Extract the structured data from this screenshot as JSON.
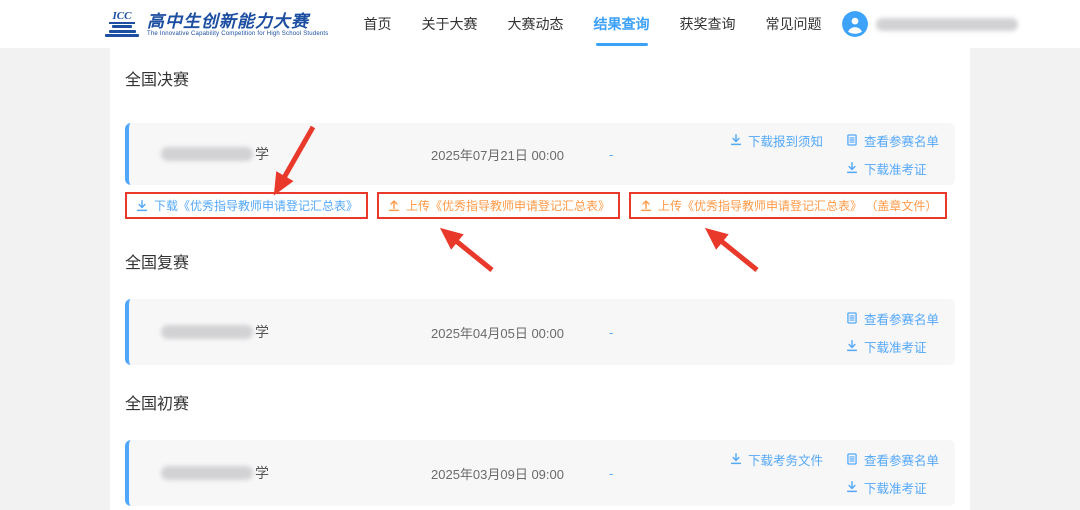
{
  "header": {
    "logo": {
      "icc": "ICC",
      "title": "高中生创新能力大赛",
      "subtitle": "The Innovative Capability Competition for High School Students"
    },
    "nav": [
      {
        "label": "首页",
        "active": false
      },
      {
        "label": "关于大赛",
        "active": false
      },
      {
        "label": "大赛动态",
        "active": false
      },
      {
        "label": "结果查询",
        "active": true
      },
      {
        "label": "获奖查询",
        "active": false
      },
      {
        "label": "常见问题",
        "active": false
      }
    ],
    "user": {
      "avatar_icon": "user-avatar-icon",
      "name_redacted": true
    }
  },
  "sections": [
    {
      "title": "全国决赛",
      "card": {
        "school_redacted": true,
        "school_suffix": "学",
        "datetime": "2025年07月21日 00:00",
        "dash": "-",
        "links": [
          {
            "icon": "download-icon",
            "label": "下载报到须知"
          },
          {
            "icon": "list-icon",
            "label": "查看参赛名单"
          },
          {
            "icon": "download-icon",
            "label": "下载准考证"
          }
        ]
      },
      "action_buttons": [
        {
          "icon": "download-icon",
          "label": "下载《优秀指导教师申请登记汇总表》",
          "color": "blue",
          "highlighted": true
        },
        {
          "icon": "upload-icon",
          "label": "上传《优秀指导教师申请登记汇总表》",
          "color": "orange",
          "highlighted": true
        },
        {
          "icon": "upload-icon",
          "label": "上传《优秀指导教师申请登记汇总表》 （盖章文件）",
          "color": "orange",
          "highlighted": true
        }
      ]
    },
    {
      "title": "全国复赛",
      "card": {
        "school_redacted": true,
        "school_suffix": "学",
        "datetime": "2025年04月05日 00:00",
        "dash": "-",
        "links": [
          {
            "icon": "list-icon",
            "label": "查看参赛名单"
          },
          {
            "icon": "download-icon",
            "label": "下载准考证"
          }
        ]
      }
    },
    {
      "title": "全国初赛",
      "card": {
        "school_redacted": true,
        "school_suffix": "学",
        "datetime": "2025年03月09日 09:00",
        "dash": "-",
        "links": [
          {
            "icon": "download-icon",
            "label": "下载考务文件"
          },
          {
            "icon": "list-icon",
            "label": "查看参赛名单"
          },
          {
            "icon": "download-icon",
            "label": "下载准考证"
          }
        ]
      }
    }
  ],
  "annotations": {
    "arrow_count": 3,
    "arrow_color": "#e8392b",
    "highlight_box_color": "#e8392b"
  },
  "colors": {
    "link_blue": "#54a8f8",
    "active_nav_blue": "#3ba1f8",
    "upload_orange": "#ff9a47",
    "card_accent_bar": "#4ea6ff",
    "card_background": "#f7f7f8",
    "logo_blue": "#1b4da0"
  }
}
